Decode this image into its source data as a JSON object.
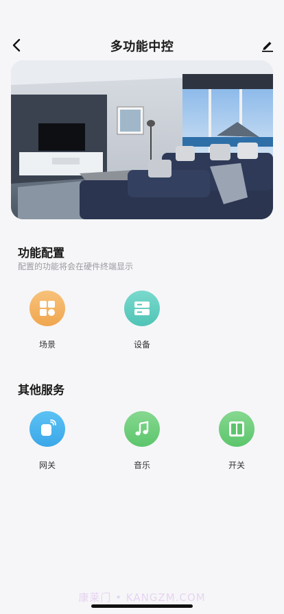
{
  "header": {
    "title": "多功能中控",
    "back_icon": "chevron-left-icon",
    "edit_icon": "pencil-icon"
  },
  "hero": {
    "image": "living-room-photo"
  },
  "function_config": {
    "title": "功能配置",
    "subtitle": "配置的功能将会在硬件终端显示",
    "items": [
      {
        "label": "场景",
        "icon": "scene-grid-icon",
        "color": "#f3b262"
      },
      {
        "label": "设备",
        "icon": "device-list-icon",
        "color": "#5fcfc2"
      }
    ]
  },
  "other_services": {
    "title": "其他服务",
    "items": [
      {
        "label": "网关",
        "icon": "gateway-icon",
        "color": "#47b2ee"
      },
      {
        "label": "音乐",
        "icon": "music-note-icon",
        "color": "#6fcf7e"
      },
      {
        "label": "开关",
        "icon": "switch-icon",
        "color": "#6fcf7e"
      }
    ]
  },
  "watermark": "康莱门 • KANGZM.COM"
}
